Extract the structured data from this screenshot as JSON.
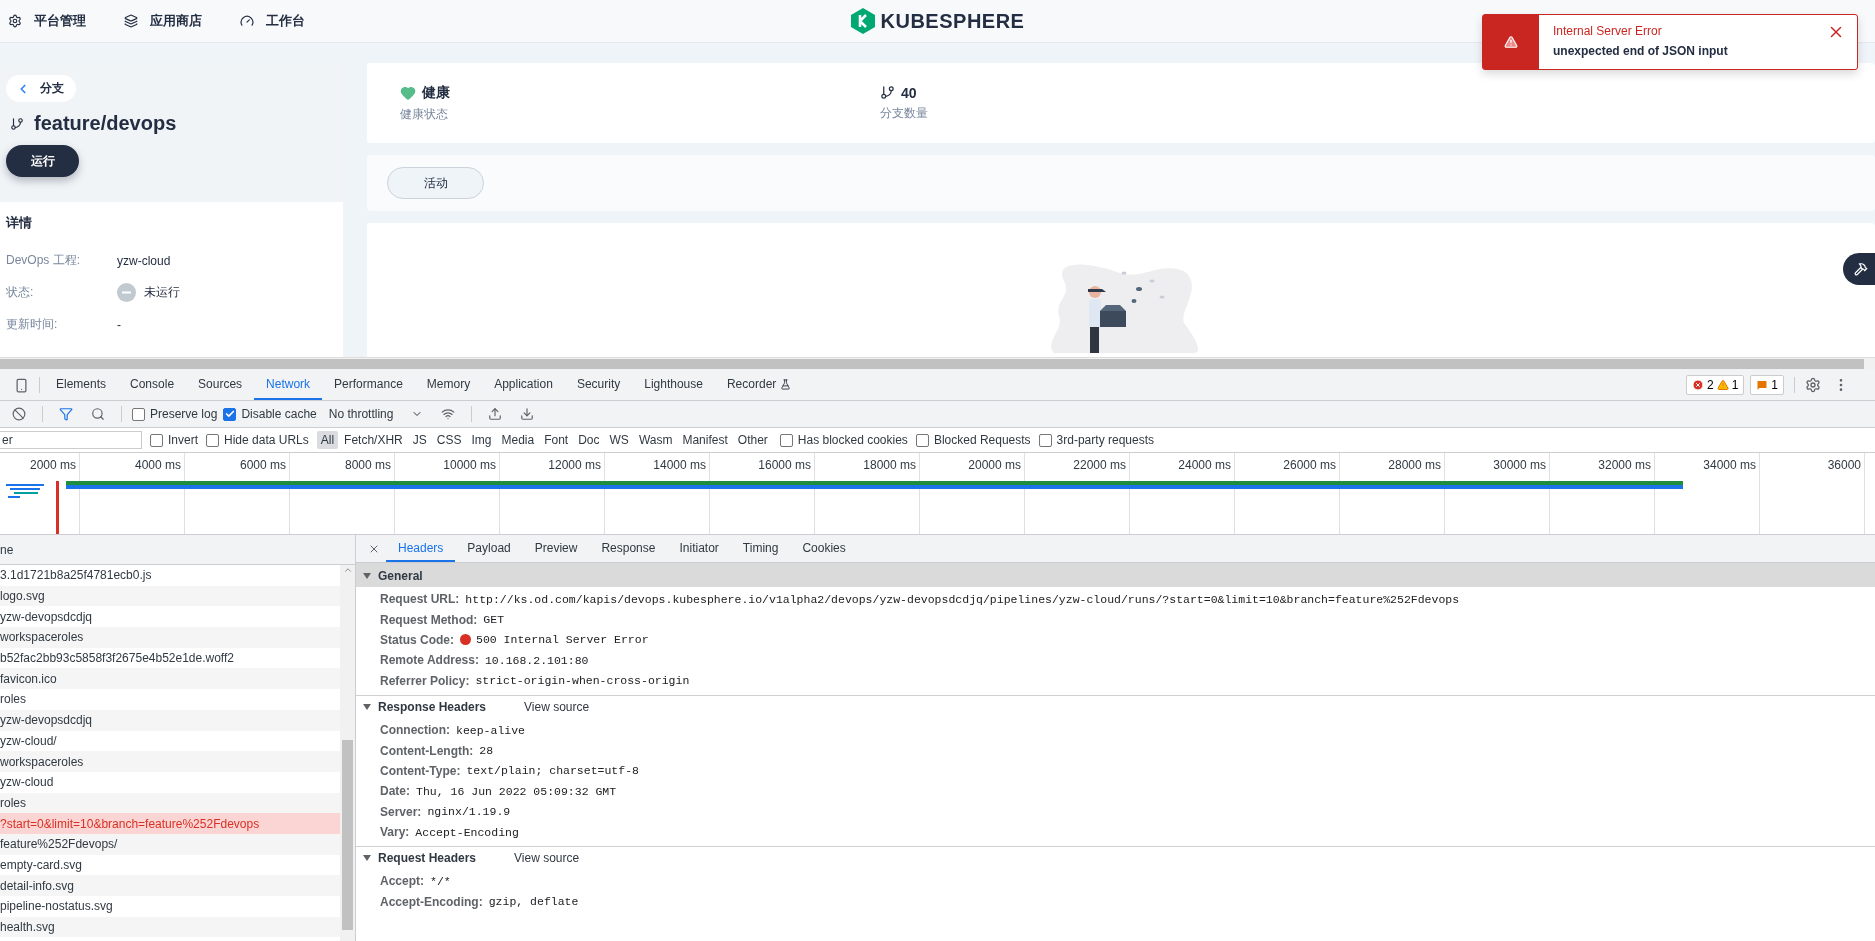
{
  "nav": {
    "items": [
      {
        "label": "平台管理"
      },
      {
        "label": "应用商店"
      },
      {
        "label": "工作台"
      }
    ],
    "logo": "KUBESPHERE"
  },
  "toast": {
    "title": "Internal Server Error",
    "message": "unexpected end of JSON input"
  },
  "branch_panel": {
    "back": "分支",
    "title": "feature/devops",
    "run_button": "运行",
    "details_title": "详情",
    "details": [
      {
        "label": "DevOps 工程:",
        "value": "yzw-cloud",
        "kind": "text"
      },
      {
        "label": "状态:",
        "value": "未运行",
        "kind": "status"
      },
      {
        "label": "更新时间:",
        "value": "-",
        "kind": "text"
      }
    ]
  },
  "stats": [
    {
      "value": "健康",
      "label": "健康状态"
    },
    {
      "value": "40",
      "label": "分支数量"
    }
  ],
  "activity_tab": "活动",
  "devtools": {
    "tabs": [
      {
        "label": "Elements",
        "selected": false
      },
      {
        "label": "Console",
        "selected": false
      },
      {
        "label": "Sources",
        "selected": false
      },
      {
        "label": "Network",
        "selected": true
      },
      {
        "label": "Performance",
        "selected": false
      },
      {
        "label": "Memory",
        "selected": false
      },
      {
        "label": "Application",
        "selected": false
      },
      {
        "label": "Security",
        "selected": false
      },
      {
        "label": "Lighthouse",
        "selected": false
      },
      {
        "label": "Recorder",
        "selected": false
      }
    ],
    "counts": {
      "errors": "2",
      "warnings": "1",
      "issues": "1"
    },
    "toolbar": {
      "checkboxes": [
        {
          "label": "Preserve log",
          "checked": false
        },
        {
          "label": "Disable cache",
          "checked": true
        }
      ],
      "throttling": "No throttling"
    },
    "filter": {
      "placeholder": "er",
      "checkboxes_before": [
        {
          "label": "Invert",
          "checked": false
        },
        {
          "label": "Hide data URLs",
          "checked": false
        }
      ],
      "types": [
        {
          "label": "All",
          "selected": true
        },
        {
          "label": "Fetch/XHR",
          "selected": false
        },
        {
          "label": "JS",
          "selected": false
        },
        {
          "label": "CSS",
          "selected": false
        },
        {
          "label": "Img",
          "selected": false
        },
        {
          "label": "Media",
          "selected": false
        },
        {
          "label": "Font",
          "selected": false
        },
        {
          "label": "Doc",
          "selected": false
        },
        {
          "label": "WS",
          "selected": false
        },
        {
          "label": "Wasm",
          "selected": false
        },
        {
          "label": "Manifest",
          "selected": false
        },
        {
          "label": "Other",
          "selected": false
        }
      ],
      "checkboxes_after": [
        {
          "label": "Has blocked cookies",
          "checked": false
        },
        {
          "label": "Blocked Requests",
          "checked": false
        },
        {
          "label": "3rd-party requests",
          "checked": false
        }
      ]
    },
    "timeline": {
      "ticks": [
        "2000 ms",
        "4000 ms",
        "6000 ms",
        "8000 ms",
        "10000 ms",
        "12000 ms",
        "14000 ms",
        "16000 ms",
        "18000 ms",
        "20000 ms",
        "22000 ms",
        "24000 ms",
        "26000 ms",
        "28000 ms",
        "30000 ms",
        "32000 ms",
        "34000 ms",
        "36000"
      ]
    }
  },
  "requests": {
    "column": "ne",
    "rows": [
      {
        "name": "3.1d1721b8a25f4781ecb0.js",
        "selected": false,
        "failed": false
      },
      {
        "name": "logo.svg",
        "selected": false,
        "failed": false
      },
      {
        "name": "yzw-devopsdcdjq",
        "selected": false,
        "failed": false
      },
      {
        "name": "workspaceroles",
        "selected": false,
        "failed": false
      },
      {
        "name": "b52fac2bb93c5858f3f2675e4b52e1de.woff2",
        "selected": false,
        "failed": false
      },
      {
        "name": "favicon.ico",
        "selected": false,
        "failed": false
      },
      {
        "name": "roles",
        "selected": false,
        "failed": false
      },
      {
        "name": "yzw-devopsdcdjq",
        "selected": false,
        "failed": false
      },
      {
        "name": "yzw-cloud/",
        "selected": false,
        "failed": false
      },
      {
        "name": "workspaceroles",
        "selected": false,
        "failed": false
      },
      {
        "name": "yzw-cloud",
        "selected": false,
        "failed": false
      },
      {
        "name": "roles",
        "selected": false,
        "failed": false
      },
      {
        "name": "?start=0&limit=10&branch=feature%252Fdevops",
        "selected": true,
        "failed": true
      },
      {
        "name": "feature%252Fdevops/",
        "selected": false,
        "failed": false
      },
      {
        "name": "empty-card.svg",
        "selected": false,
        "failed": false
      },
      {
        "name": "detail-info.svg",
        "selected": false,
        "failed": false
      },
      {
        "name": "pipeline-nostatus.svg",
        "selected": false,
        "failed": false
      },
      {
        "name": "health.svg",
        "selected": false,
        "failed": false
      }
    ]
  },
  "detail": {
    "tabs": [
      {
        "label": "Headers",
        "selected": true
      },
      {
        "label": "Payload",
        "selected": false
      },
      {
        "label": "Preview",
        "selected": false
      },
      {
        "label": "Response",
        "selected": false
      },
      {
        "label": "Initiator",
        "selected": false
      },
      {
        "label": "Timing",
        "selected": false
      },
      {
        "label": "Cookies",
        "selected": false
      }
    ],
    "sections": [
      {
        "title": "General",
        "expanded": true,
        "shaded": true,
        "rows": [
          {
            "key": "Request URL:",
            "value": "http://ks.od.com/kapis/devops.kubesphere.io/v1alpha2/devops/yzw-devopsdcdjq/pipelines/yzw-cloud/runs/?start=0&limit=10&branch=feature%252Fdevops",
            "kind": "text"
          },
          {
            "key": "Request Method:",
            "value": "GET",
            "kind": "text"
          },
          {
            "key": "Status Code:",
            "value": "500 Internal Server Error",
            "kind": "status"
          },
          {
            "key": "Remote Address:",
            "value": "10.168.2.101:80",
            "kind": "text"
          },
          {
            "key": "Referrer Policy:",
            "value": "strict-origin-when-cross-origin",
            "kind": "text"
          }
        ]
      },
      {
        "title": "Response Headers",
        "expanded": true,
        "shaded": false,
        "action": "View source",
        "rows": [
          {
            "key": "Connection:",
            "value": "keep-alive",
            "kind": "text"
          },
          {
            "key": "Content-Length:",
            "value": "28",
            "kind": "text"
          },
          {
            "key": "Content-Type:",
            "value": "text/plain; charset=utf-8",
            "kind": "text"
          },
          {
            "key": "Date:",
            "value": "Thu, 16 Jun 2022 05:09:32 GMT",
            "kind": "text"
          },
          {
            "key": "Server:",
            "value": "nginx/1.19.9",
            "kind": "text"
          },
          {
            "key": "Vary:",
            "value": "Accept-Encoding",
            "kind": "text"
          }
        ]
      },
      {
        "title": "Request Headers",
        "expanded": true,
        "shaded": false,
        "action": "View source",
        "rows": [
          {
            "key": "Accept:",
            "value": "*/*",
            "kind": "text"
          },
          {
            "key": "Accept-Encoding:",
            "value": "gzip, deflate",
            "kind": "text"
          }
        ]
      }
    ]
  }
}
